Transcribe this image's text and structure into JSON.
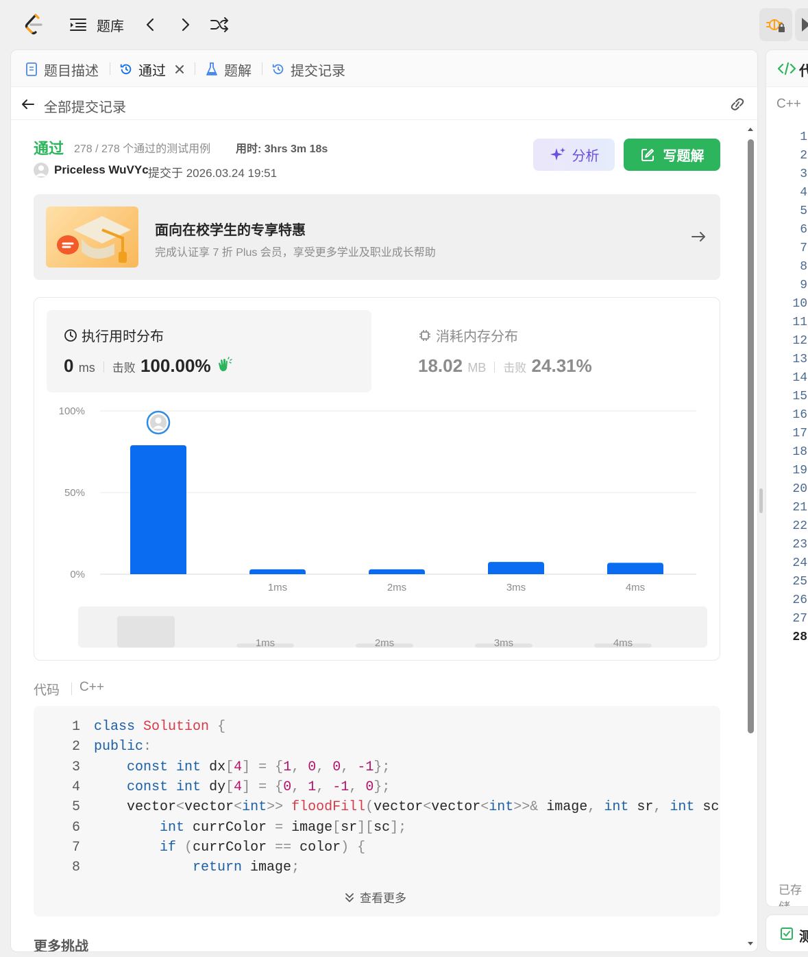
{
  "topbar": {
    "title": "题库"
  },
  "tabs": [
    {
      "label": "题目描述"
    },
    {
      "label": "通过"
    },
    {
      "label": "题解"
    },
    {
      "label": "提交记录"
    }
  ],
  "subheader": {
    "title": "全部提交记录"
  },
  "submission": {
    "status": "通过",
    "testcases": "278 / 278 个通过的测试用例",
    "runtime": "用时: 3hrs 3m 18s",
    "user": "Priceless WuVYc",
    "submitted_at": "提交于 2026.03.24 19:51",
    "analyze_label": "分析",
    "write_solution_label": "写题解"
  },
  "promo": {
    "title": "面向在校学生的专享特惠",
    "subtitle": "完成认证享 7 折 Plus 会员，享受更多学业及职业成长帮助"
  },
  "stats": {
    "runtime": {
      "title": "执行用时分布",
      "value": "0",
      "unit": "ms",
      "beat_label": "击败",
      "beat_value": "100.00%"
    },
    "memory": {
      "title": "消耗内存分布",
      "value": "18.02",
      "unit": "MB",
      "beat_label": "击败",
      "beat_value": "24.31%"
    }
  },
  "chart_data": {
    "type": "bar",
    "categories": [
      "",
      "1ms",
      "2ms",
      "3ms",
      "4ms"
    ],
    "values": [
      79,
      3,
      3,
      7.5,
      7
    ],
    "ylim": [
      0,
      100
    ],
    "yticks": [
      "0%",
      "50%",
      "100%"
    ],
    "highlighted_index": 0,
    "grid": true
  },
  "brush": {
    "labels": [
      "1ms",
      "2ms",
      "3ms",
      "4ms"
    ]
  },
  "code": {
    "label": "代码",
    "lang": "C++",
    "more_label": "查看更多",
    "lines": [
      {
        "n": "1",
        "tokens": [
          [
            "kw",
            "class"
          ],
          [
            "src",
            " "
          ],
          [
            "ty",
            "Solution"
          ],
          [
            "src",
            " "
          ],
          [
            "pun",
            "{"
          ]
        ]
      },
      {
        "n": "2",
        "tokens": [
          [
            "kw",
            "public"
          ],
          [
            "pun",
            ":"
          ]
        ]
      },
      {
        "n": "3",
        "tokens": [
          [
            "src",
            "    "
          ],
          [
            "kw",
            "const"
          ],
          [
            "src",
            " "
          ],
          [
            "kw",
            "int"
          ],
          [
            "src",
            " dx"
          ],
          [
            "pun",
            "["
          ],
          [
            "num",
            "4"
          ],
          [
            "pun",
            "]"
          ],
          [
            "src",
            " "
          ],
          [
            "pun",
            "="
          ],
          [
            "src",
            " "
          ],
          [
            "pun",
            "{"
          ],
          [
            "num",
            "1"
          ],
          [
            "pun",
            ","
          ],
          [
            "src",
            " "
          ],
          [
            "num",
            "0"
          ],
          [
            "pun",
            ","
          ],
          [
            "src",
            " "
          ],
          [
            "num",
            "0"
          ],
          [
            "pun",
            ","
          ],
          [
            "src",
            " "
          ],
          [
            "num",
            "-1"
          ],
          [
            "pun",
            "};"
          ]
        ]
      },
      {
        "n": "4",
        "tokens": [
          [
            "src",
            "    "
          ],
          [
            "kw",
            "const"
          ],
          [
            "src",
            " "
          ],
          [
            "kw",
            "int"
          ],
          [
            "src",
            " dy"
          ],
          [
            "pun",
            "["
          ],
          [
            "num",
            "4"
          ],
          [
            "pun",
            "]"
          ],
          [
            "src",
            " "
          ],
          [
            "pun",
            "="
          ],
          [
            "src",
            " "
          ],
          [
            "pun",
            "{"
          ],
          [
            "num",
            "0"
          ],
          [
            "pun",
            ","
          ],
          [
            "src",
            " "
          ],
          [
            "num",
            "1"
          ],
          [
            "pun",
            ","
          ],
          [
            "src",
            " "
          ],
          [
            "num",
            "-1"
          ],
          [
            "pun",
            ","
          ],
          [
            "src",
            " "
          ],
          [
            "num",
            "0"
          ],
          [
            "pun",
            "};"
          ]
        ]
      },
      {
        "n": "5",
        "tokens": [
          [
            "src",
            "    vector"
          ],
          [
            "pun",
            "<"
          ],
          [
            "src",
            "vector"
          ],
          [
            "pun",
            "<"
          ],
          [
            "kw",
            "int"
          ],
          [
            "pun",
            ">>"
          ],
          [
            "src",
            " "
          ],
          [
            "fn",
            "floodFill"
          ],
          [
            "pun",
            "("
          ],
          [
            "src",
            "vector"
          ],
          [
            "pun",
            "<"
          ],
          [
            "src",
            "vector"
          ],
          [
            "pun",
            "<"
          ],
          [
            "kw",
            "int"
          ],
          [
            "pun",
            ">>&"
          ],
          [
            "src",
            " image"
          ],
          [
            "pun",
            ","
          ],
          [
            "src",
            " "
          ],
          [
            "kw",
            "int"
          ],
          [
            "src",
            " sr"
          ],
          [
            "pun",
            ","
          ],
          [
            "src",
            " "
          ],
          [
            "kw",
            "int"
          ],
          [
            "src",
            " sc"
          ]
        ]
      },
      {
        "n": "6",
        "tokens": [
          [
            "src",
            "        "
          ],
          [
            "kw",
            "int"
          ],
          [
            "src",
            " currColor "
          ],
          [
            "pun",
            "="
          ],
          [
            "src",
            " image"
          ],
          [
            "pun",
            "["
          ],
          [
            "src",
            "sr"
          ],
          [
            "pun",
            "]["
          ],
          [
            "src",
            "sc"
          ],
          [
            "pun",
            "];"
          ]
        ]
      },
      {
        "n": "7",
        "tokens": [
          [
            "src",
            "        "
          ],
          [
            "kw",
            "if"
          ],
          [
            "src",
            " "
          ],
          [
            "pun",
            "("
          ],
          [
            "src",
            "currColor "
          ],
          [
            "pun",
            "=="
          ],
          [
            "src",
            " color"
          ],
          [
            "pun",
            ")"
          ],
          [
            "src",
            " "
          ],
          [
            "pun",
            "{"
          ]
        ]
      },
      {
        "n": "8",
        "tokens": [
          [
            "src",
            "            "
          ],
          [
            "kw",
            "return"
          ],
          [
            "src",
            " image"
          ],
          [
            "pun",
            ";"
          ]
        ]
      }
    ]
  },
  "more_challenges": "更多挑战",
  "right_panel": {
    "title": "代",
    "lang": "C++",
    "line_numbers": [
      "1",
      "2",
      "3",
      "4",
      "5",
      "6",
      "7",
      "8",
      "9",
      "10",
      "11",
      "12",
      "13",
      "14",
      "15",
      "16",
      "17",
      "18",
      "19",
      "20",
      "21",
      "22",
      "23",
      "24",
      "25",
      "26",
      "27",
      "28"
    ],
    "saved": "已存储",
    "test_label": "测"
  },
  "colors": {
    "accent_green": "#2db55d",
    "bar_blue": "#0a6cf0",
    "analyze_purple": "#6a4fe0"
  }
}
